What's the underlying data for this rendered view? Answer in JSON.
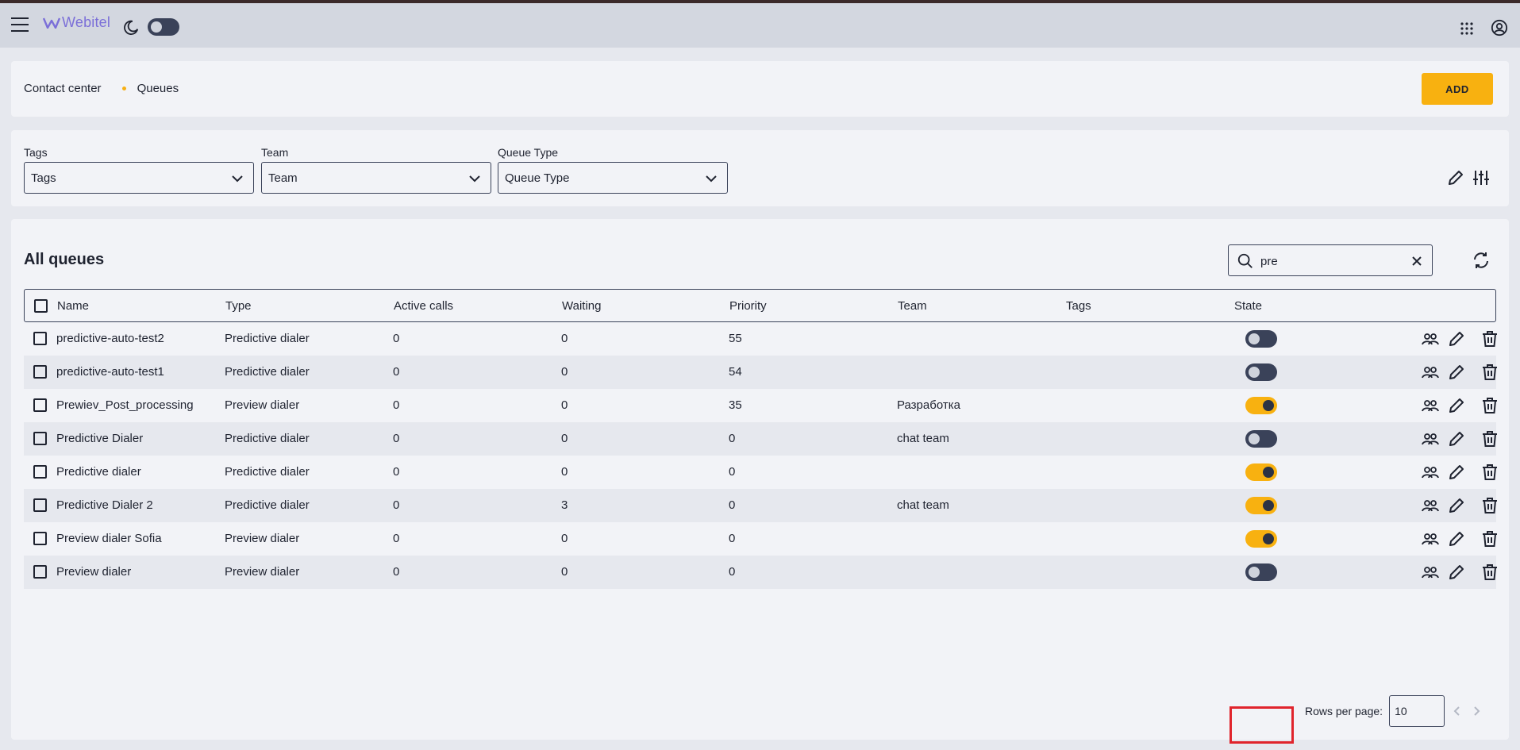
{
  "app": {
    "name": "Webitel"
  },
  "breadcrumb": [
    "Contact center",
    "Queues"
  ],
  "header": {
    "add_label": "ADD"
  },
  "filters": [
    {
      "label": "Tags",
      "value": "Tags"
    },
    {
      "label": "Team",
      "value": "Team"
    },
    {
      "label": "Queue Type",
      "value": "Queue Type"
    }
  ],
  "section": {
    "title": "All queues"
  },
  "search": {
    "value": "pre"
  },
  "table": {
    "columns": [
      "Name",
      "Type",
      "Active calls",
      "Waiting",
      "Priority",
      "Team",
      "Tags",
      "State"
    ],
    "rows": [
      {
        "name": "predictive-auto-test2",
        "type": "Predictive dialer",
        "active": "0",
        "waiting": "0",
        "priority": "55",
        "team": "",
        "tags": "",
        "state": "off"
      },
      {
        "name": "predictive-auto-test1",
        "type": "Predictive dialer",
        "active": "0",
        "waiting": "0",
        "priority": "54",
        "team": "",
        "tags": "",
        "state": "off"
      },
      {
        "name": "Prewiev_Post_processing",
        "type": "Preview dialer",
        "active": "0",
        "waiting": "0",
        "priority": "35",
        "team": "Разработка",
        "tags": "",
        "state": "on"
      },
      {
        "name": "Predictive Dialer",
        "type": "Predictive dialer",
        "active": "0",
        "waiting": "0",
        "priority": "0",
        "team": "chat team",
        "tags": "",
        "state": "off"
      },
      {
        "name": "Predictive dialer",
        "type": "Predictive dialer",
        "active": "0",
        "waiting": "0",
        "priority": "0",
        "team": "",
        "tags": "",
        "state": "on"
      },
      {
        "name": "Predictive Dialer 2",
        "type": "Predictive dialer",
        "active": "0",
        "waiting": "3",
        "priority": "0",
        "team": "chat team",
        "tags": "",
        "state": "on"
      },
      {
        "name": "Preview dialer Sofia",
        "type": "Preview dialer",
        "active": "0",
        "waiting": "0",
        "priority": "0",
        "team": "",
        "tags": "",
        "state": "on"
      },
      {
        "name": "Preview dialer",
        "type": "Preview dialer",
        "active": "0",
        "waiting": "0",
        "priority": "0",
        "team": "",
        "tags": "",
        "state": "off"
      }
    ]
  },
  "pagination": {
    "label": "Rows per page:",
    "value": "10"
  },
  "colors": {
    "accent": "#f8b110",
    "dark": "#3a4259",
    "highlight": "#e0242c"
  }
}
